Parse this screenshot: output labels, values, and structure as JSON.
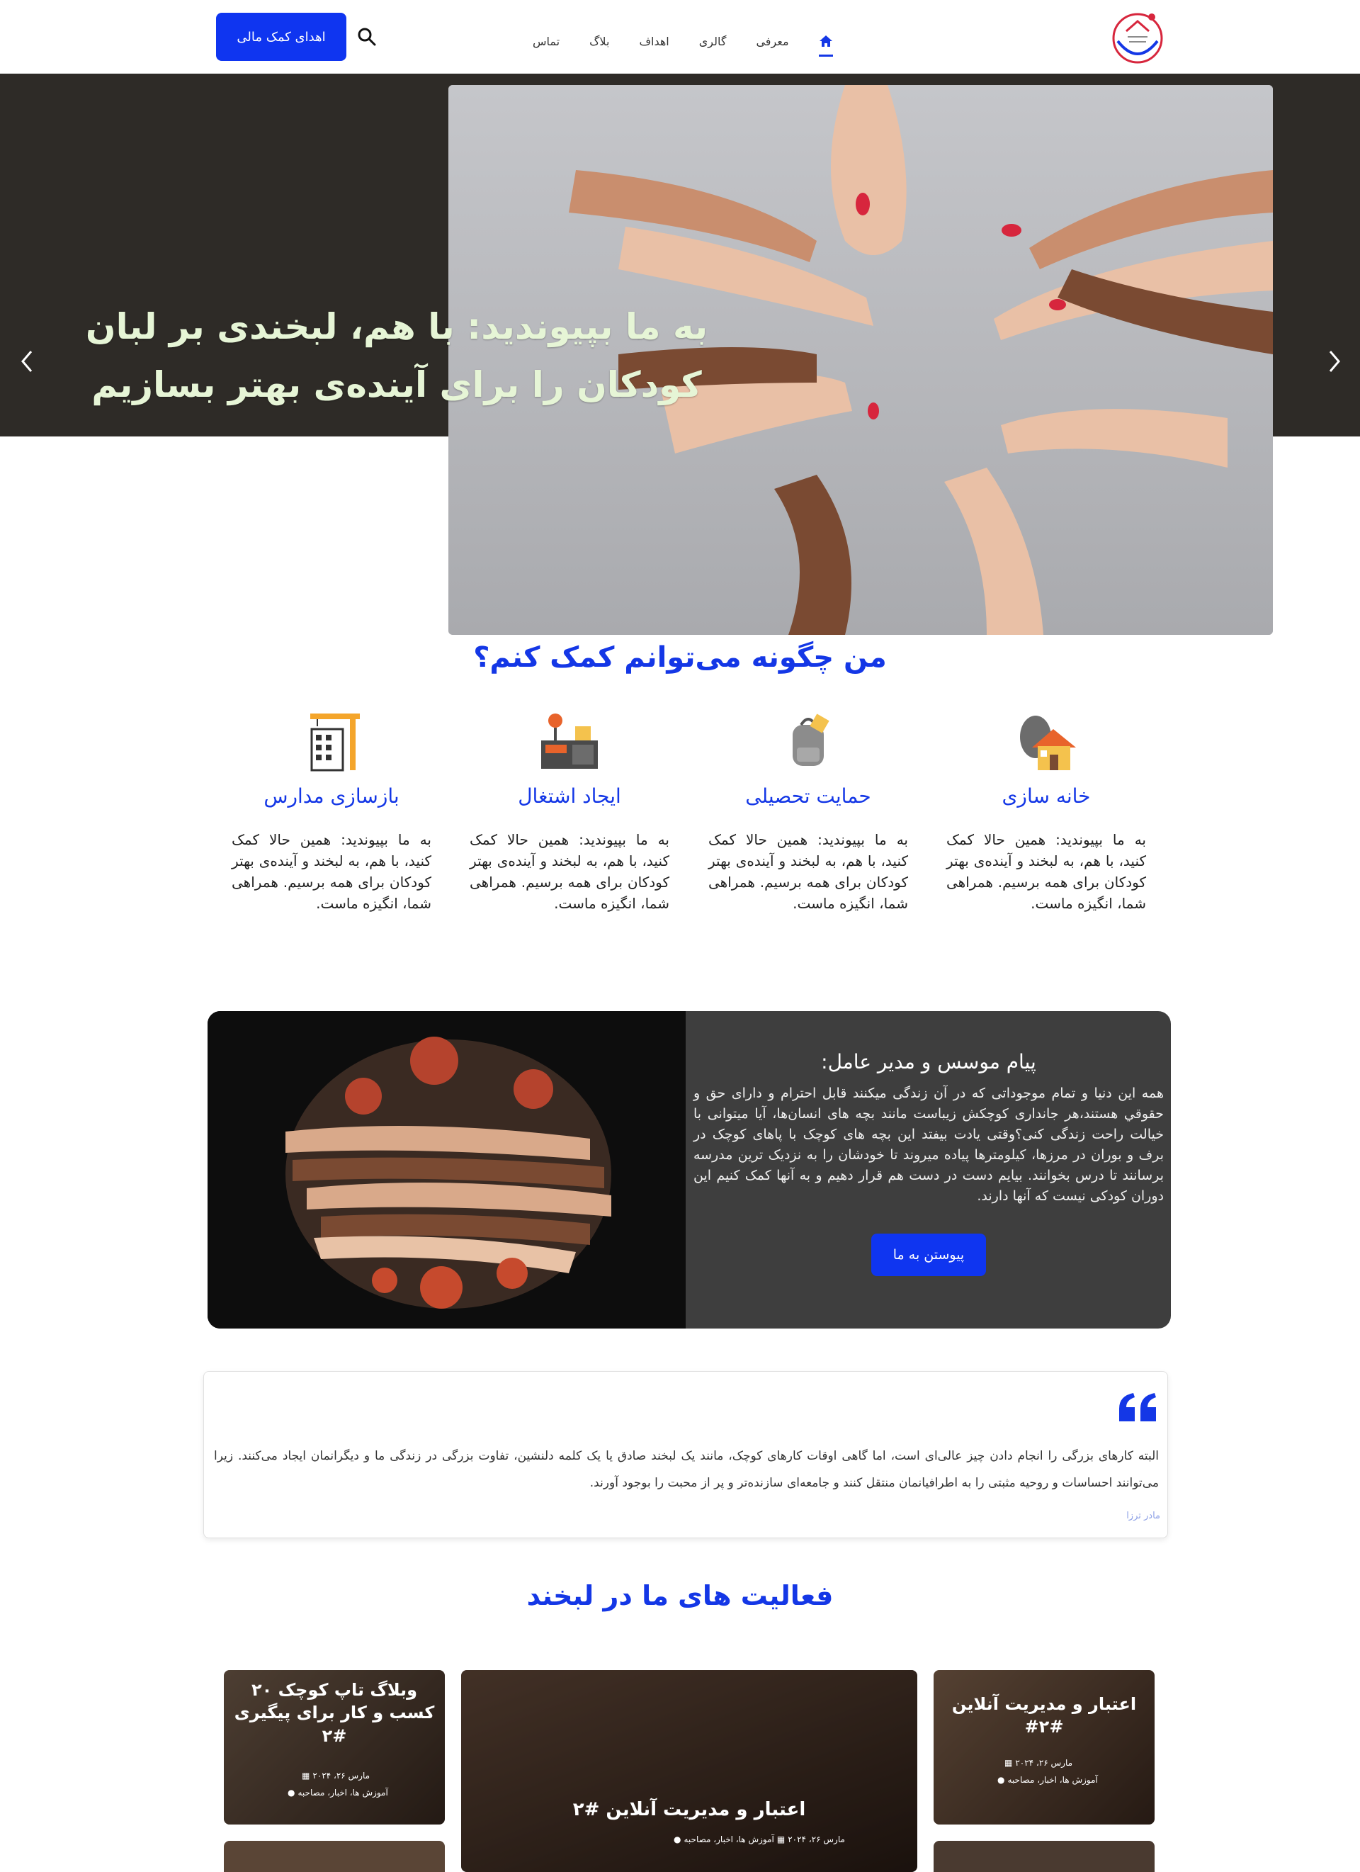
{
  "header": {
    "nav": [
      {
        "label": "معرفی"
      },
      {
        "label": "گالری"
      },
      {
        "label": "اهداف"
      },
      {
        "label": "بلاگ"
      },
      {
        "label": "تماس"
      }
    ],
    "donate_label": "اهدای کمک مالی"
  },
  "hero": {
    "title_line1": "به ما بپیوندید: با هم، لبخندی بر لبان",
    "title_line2": "کودکان را برای آینده‌ی بهتر بسازیم"
  },
  "help": {
    "title": "من چگونه می‌توانم کمک کنم؟",
    "items": [
      {
        "title": "خانه سازی",
        "text": "به ما بپیوندید: همین حالا کمک کنید، با هم، به لبخند و آینده‌ی بهتر کودکان برای همه برسیم. همراهی شما، انگیزه ماست.",
        "icon": "house-icon"
      },
      {
        "title": "حمایت تحصیلی",
        "text": "به ما بپیوندید: همین حالا کمک کنید، با هم، به لبخند و آینده‌ی بهتر کودکان برای همه برسیم. همراهی شما، انگیزه ماست.",
        "icon": "backpack-icon"
      },
      {
        "title": "ایجاد اشتغال",
        "text": "به ما بپیوندید: همین حالا کمک کنید، با هم، به لبخند و آینده‌ی بهتر کودکان برای همه برسیم. همراهی شما، انگیزه ماست.",
        "icon": "workshop-icon"
      },
      {
        "title": "بازسازی مدارس",
        "text": "به ما بپیوندید: همین حالا کمک کنید، با هم، به لبخند و آینده‌ی بهتر کودکان برای همه برسیم. همراهی شما، انگیزه ماست.",
        "icon": "construction-icon"
      }
    ]
  },
  "founder": {
    "title": "پیام موسس و مدیر عامل:",
    "text": "همه این دنیا و تمام موجوداتی که در آن زندگی میکنند قابل احترام و دارای حق و حقوقي هستند،هر جانداری کوچکش زیباست مانند بچه های انسان‌ها، آیا میتوانی با خیالت راحت زندگی کنی؟وقتی یادت بیفتد این بچه های کوچک با پاهای کوچک در برف و بوران در مرزها، کیلومترها پیاده میروند تا خودشان را به نزدیک ترین مدرسه برسانند تا درس بخوانند. بیایم دست در دست هم قرار دهیم و به آنها کمک کنیم این دوران کودکی نیست که آنها دارند.",
    "button": "پیوستن به ما"
  },
  "quote": {
    "text": "البته کارهای بزرگی را انجام دادن چیز عالی‌ای است، اما گاهی اوقات کارهای کوچک، مانند یک لبخند صادق یا یک کلمه دلنشین، تفاوت بزرگی در زندگی ما و دیگرانمان ایجاد می‌کنند. زیرا می‌توانند احساسات و روحیه مثبتی را به اطرافیانمان منتقل کنند و جامعه‌ای سازنده‌تر و پر از محبت را بوجود آورند.",
    "author": "مادر ترزا"
  },
  "activities": {
    "title": "فعالیت های ما در لبخند",
    "cards": [
      {
        "title": "اعتبار و مدیریت آنلاین #۲#",
        "date": "مارس ۲۶، ۲۰۲۴",
        "tags": "آموزش ها، اخبار، مصاحبه"
      },
      {
        "title": "اعتبار و مدیریت آنلاین #۲",
        "date": "مارس ۲۶، ۲۰۲۴",
        "tags": "آموزش ها، اخبار، مصاحبه"
      },
      {
        "title": "وبلاگ تاپ کوچک ۲۰ کسب و کار برای پیگیری #۲",
        "date": "مارس ۲۶، ۲۰۲۴",
        "tags": "آموزش ها، اخبار، مصاحبه"
      }
    ]
  },
  "colors": {
    "accent": "#1437e6",
    "button": "#0f35f0",
    "hero_bg": "#2e2b27",
    "founder_bg": "#3e3e3e"
  }
}
